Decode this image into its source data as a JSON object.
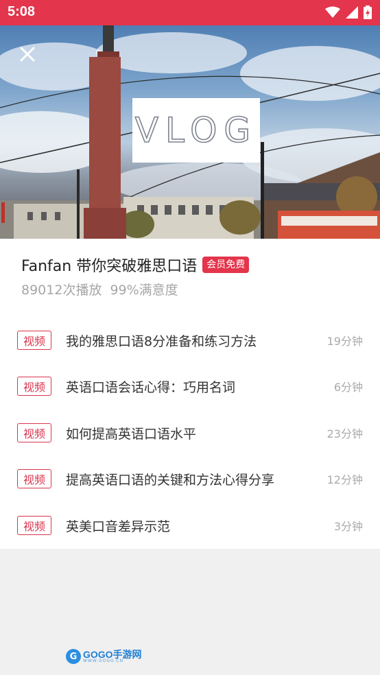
{
  "status_bar": {
    "time": "5:08"
  },
  "hero": {
    "vlog_text": "VLOG"
  },
  "course": {
    "title": "Fanfan 带你突破雅思口语",
    "badge": "会员免费",
    "plays": "89012次播放",
    "satisfaction": "99%满意度"
  },
  "lessons": [
    {
      "tag": "视频",
      "title": "我的雅思口语8分准备和练习方法",
      "duration": "19分钟"
    },
    {
      "tag": "视频",
      "title": "英语口语会话心得：巧用名词",
      "duration": "6分钟"
    },
    {
      "tag": "视频",
      "title": "如何提高英语口语水平",
      "duration": "23分钟"
    },
    {
      "tag": "视频",
      "title": "提高英语口语的关键和方法心得分享",
      "duration": "12分钟"
    },
    {
      "tag": "视频",
      "title": "英美口音差异示范",
      "duration": "3分钟"
    }
  ],
  "watermark": {
    "brand": "GOGO手游网",
    "url": "WWW.GOGO.CN"
  },
  "colors": {
    "accent": "#e3354b",
    "tag": "#d9344d"
  },
  "icons": [
    "wifi-icon",
    "signal-icon",
    "battery-icon",
    "close-icon"
  ]
}
